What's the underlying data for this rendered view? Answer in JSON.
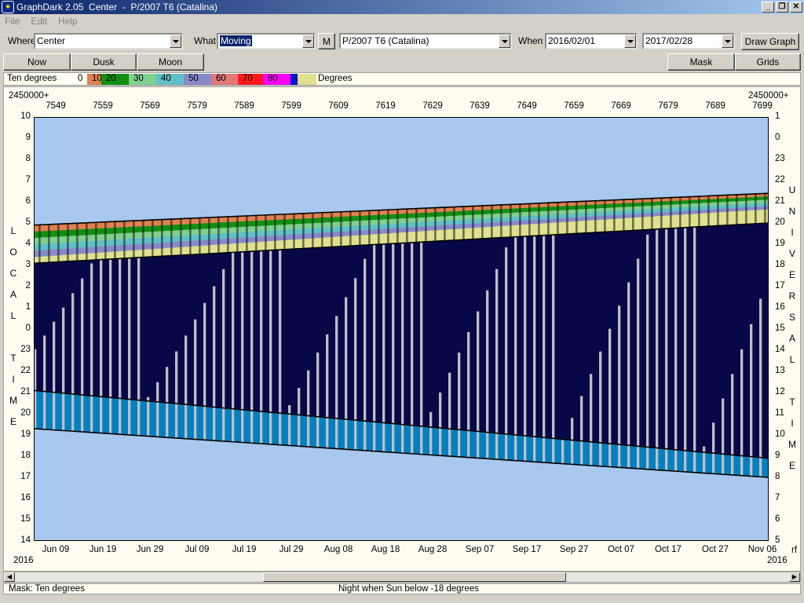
{
  "window": {
    "title": "GraphDark 2.05  Center  -  P/2007 T6 (Catalina)",
    "icon": "owl-icon",
    "buttons": [
      "_",
      "❐",
      "✕"
    ]
  },
  "menu": [
    "File",
    "Edit",
    "Help"
  ],
  "toolbar": {
    "where_label": "Where",
    "where_value": "Center",
    "what_label": "What",
    "what_value": "Moving",
    "m_button": "M",
    "object_value": "P/2007 T6 (Catalina)",
    "when_label": "When",
    "start_date": "2016/02/01",
    "end_date": "2017/02/28",
    "draw_button": "Draw Graph"
  },
  "buttons": {
    "now": "Now",
    "dusk": "Dusk",
    "moon": "Moon",
    "mask": "Mask",
    "grids": "Grids"
  },
  "legend": {
    "label": "Ten degrees",
    "unit": "Degrees",
    "items": [
      {
        "text": "0",
        "color": "#fefcf0"
      },
      {
        "text": "10",
        "color": "#e08050"
      },
      {
        "text": "20",
        "color": "#109010"
      },
      {
        "text": "30",
        "color": "#80d090"
      },
      {
        "text": "40",
        "color": "#60c0c8"
      },
      {
        "text": "50",
        "color": "#8888cc"
      },
      {
        "text": "60",
        "color": "#e07878"
      },
      {
        "text": "70",
        "color": "#ff1a1a"
      },
      {
        "text": "80",
        "color": "#ff00ff"
      },
      {
        "text": "0",
        "color": "#0018d8"
      },
      {
        "text": "",
        "color": "#e0e090"
      }
    ]
  },
  "chart": {
    "jd_prefix_left": "2450000+",
    "jd_prefix_right": "2450000+",
    "year_left": "2016",
    "year_right": "2016",
    "right_corner": "rf",
    "left_axis_title": "LOCAL TIME",
    "right_axis_title": "UNIVERSAL TIME",
    "colors": {
      "background": "#a8c8ee",
      "dark_night": "#080848",
      "moonlit": "#bfbfc4",
      "twilight_band": "#0480c0"
    }
  },
  "chart_data": {
    "type": "heatmap",
    "top_ticks": [
      "7549",
      "7559",
      "7569",
      "7579",
      "7589",
      "7599",
      "7609",
      "7619",
      "7629",
      "7639",
      "7649",
      "7659",
      "7669",
      "7679",
      "7689",
      "7699"
    ],
    "bottom_ticks": [
      "Jun 09",
      "Jun 19",
      "Jun 29",
      "Jul 09",
      "Jul 19",
      "Jul 29",
      "Aug 08",
      "Aug 18",
      "Aug 28",
      "Sep 07",
      "Sep 17",
      "Sep 27",
      "Oct 07",
      "Oct 17",
      "Oct 27",
      "Nov 06"
    ],
    "left_ticks": [
      "10",
      "9",
      "8",
      "7",
      "6",
      "5",
      "4",
      "3",
      "2",
      "1",
      "0",
      "23",
      "22",
      "21",
      "20",
      "19",
      "18",
      "17",
      "16",
      "15",
      "14"
    ],
    "right_ticks": [
      "1",
      "0",
      "23",
      "22",
      "21",
      "20",
      "19",
      "18",
      "17",
      "16",
      "15",
      "14",
      "13",
      "12",
      "11",
      "10",
      "9",
      "8",
      "7",
      "6",
      "5"
    ],
    "xlabel": "",
    "ylabel_left": "LOCAL TIME",
    "ylabel_right": "UNIVERSAL TIME",
    "object_rise_local": {
      "start": 4.9,
      "end": 6.4
    },
    "object_set_local": {
      "start": 3.1,
      "end": 5.0
    },
    "dusk_local": {
      "start": 21.1,
      "end": 17.9
    },
    "dawn_local": {
      "start": 3.0,
      "end": 18.0
    },
    "sunset_local": {
      "start": 19.3,
      "end": 17.0
    }
  },
  "status": {
    "mask": "Mask:  Ten degrees",
    "night": "Night when Sun below -18 degrees"
  }
}
